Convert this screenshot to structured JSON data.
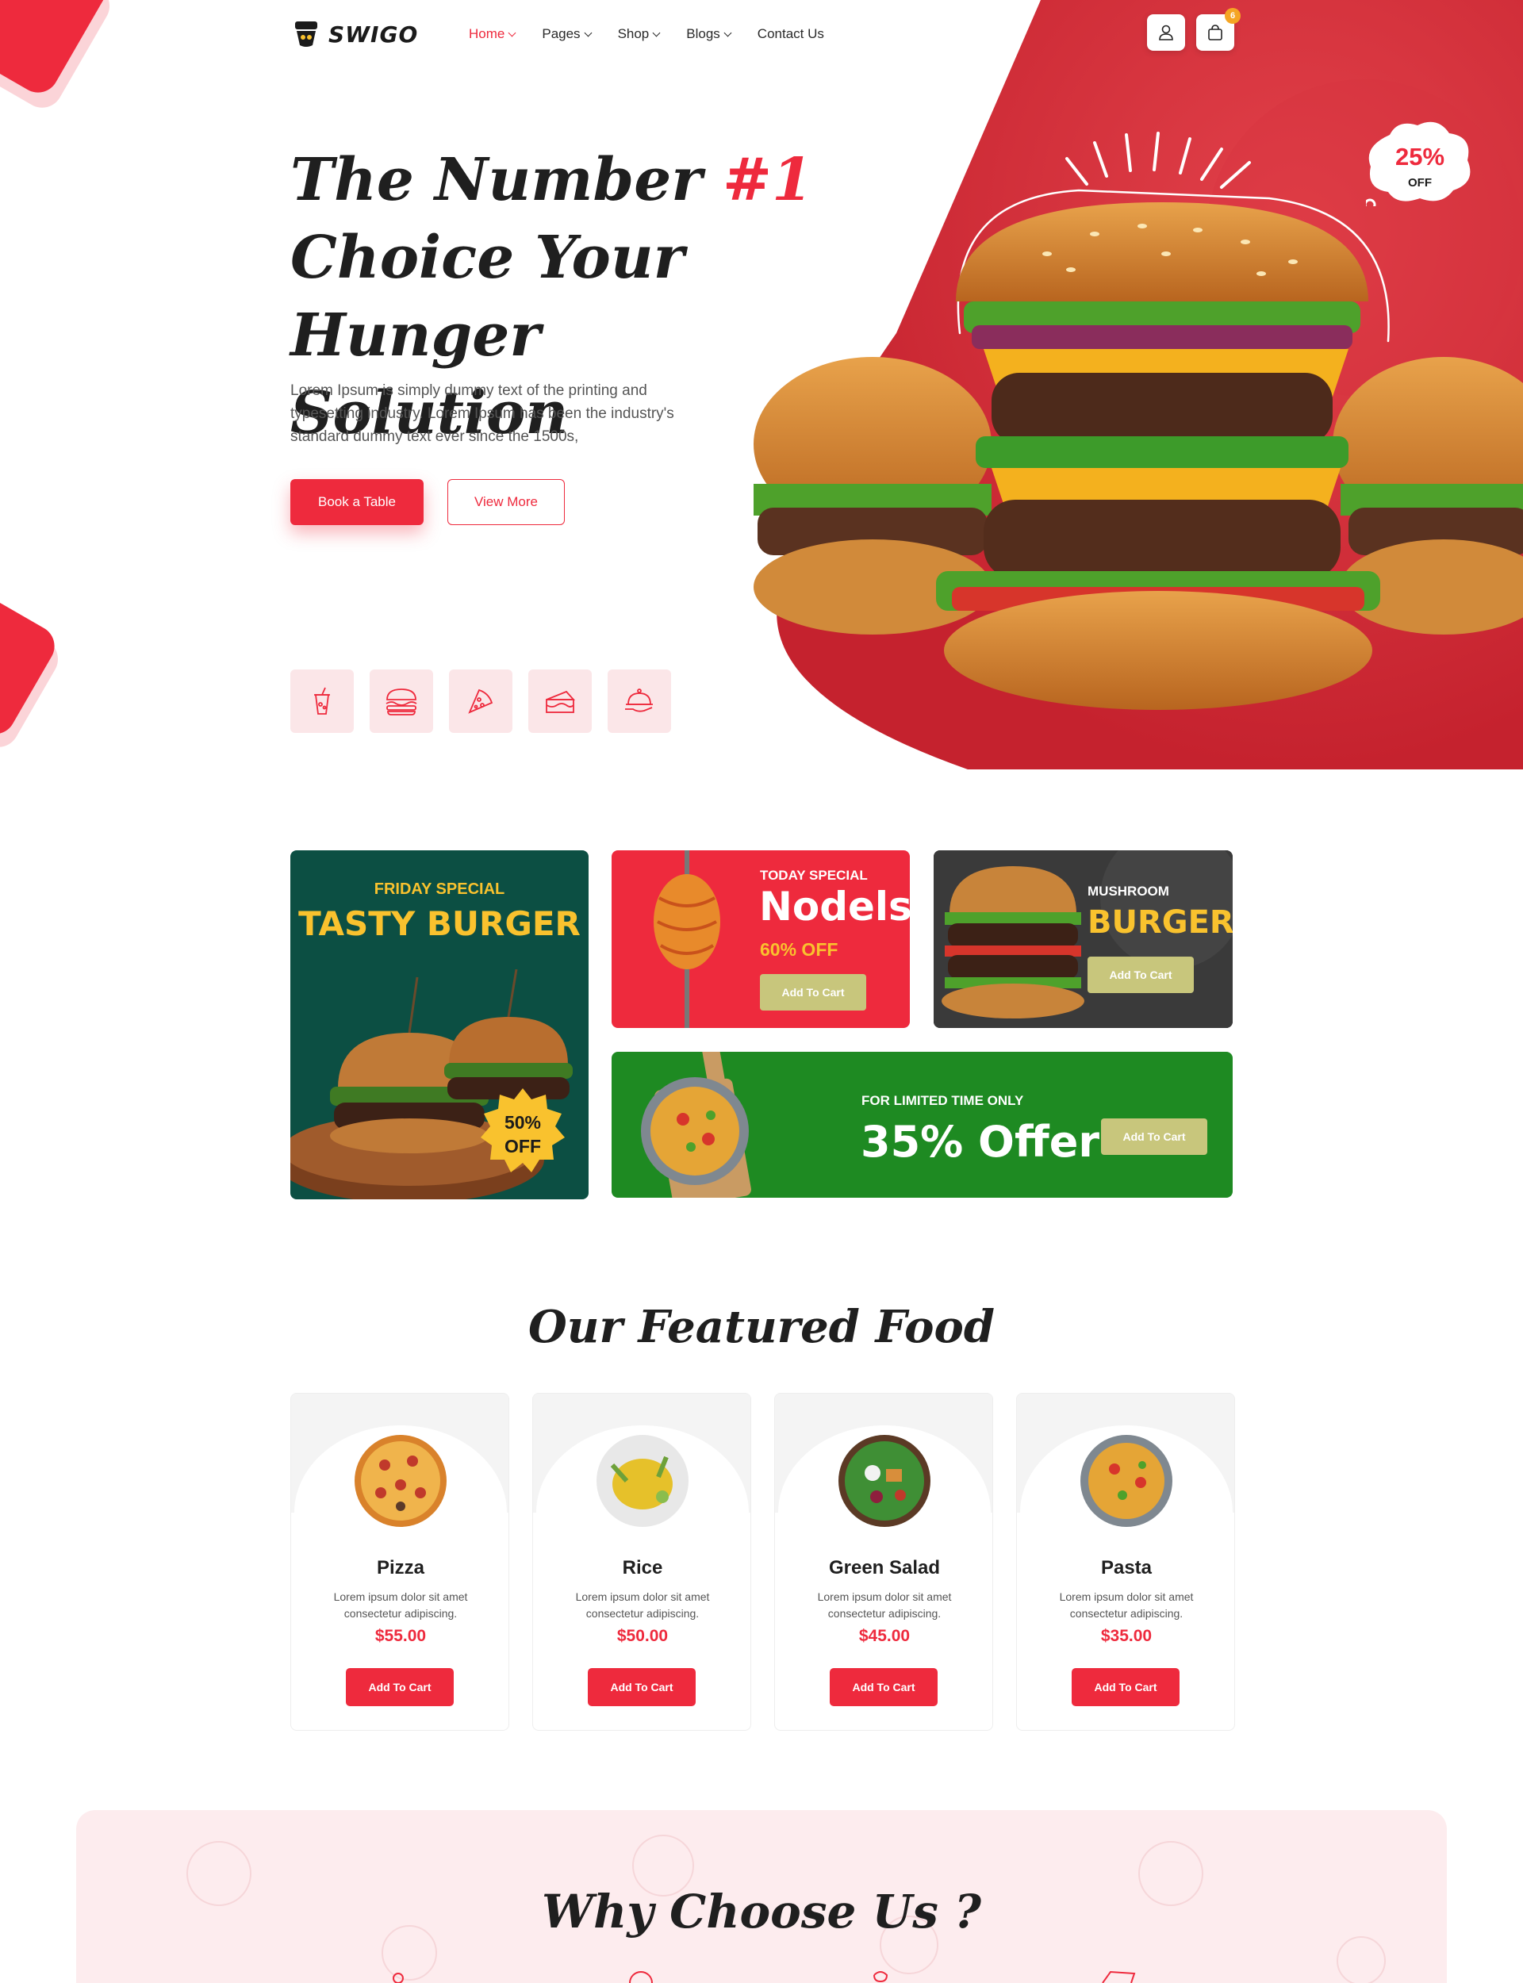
{
  "brand": {
    "name": "SWIGO"
  },
  "nav": {
    "items": [
      {
        "label": "Home",
        "active": true,
        "has_dropdown": true
      },
      {
        "label": "Pages",
        "has_dropdown": true
      },
      {
        "label": "Shop",
        "has_dropdown": true
      },
      {
        "label": "Blogs",
        "has_dropdown": true
      },
      {
        "label": "Contact Us",
        "has_dropdown": false
      }
    ]
  },
  "header_icons": {
    "user": "user-icon",
    "cart": "shopping-bag-icon",
    "cart_count": "6"
  },
  "hero": {
    "title_line1": "The Number ",
    "title_accent": "#1",
    "title_line2": "Choice Your Hunger",
    "title_line3": "Solution",
    "description": "Lorem Ipsum is simply dummy text of the printing and typesetting industry. Lorem Ipsum has been the industry's standard dummy text ever since the 1500s,",
    "primary_button": "Book a Table",
    "secondary_button": "View More",
    "discount_value": "25%",
    "discount_label": "OFF",
    "categories": [
      "drink-icon",
      "burger-icon",
      "pizza-icon",
      "cake-icon",
      "food-serving-icon"
    ]
  },
  "promos": {
    "friday": {
      "kicker": "FRIDAY SPECIAL",
      "title": "TASTY BURGER",
      "badge_value": "50%",
      "badge_label": "OFF"
    },
    "today": {
      "kicker": "TODAY SPECIAL",
      "title": "Nodels",
      "discount": "60% OFF",
      "button": "Add To Cart"
    },
    "mushroom": {
      "kicker": "MUSHROOM",
      "title": "BURGER",
      "button": "Add To Cart"
    },
    "limited": {
      "kicker": "FOR LIMITED TIME ONLY",
      "title": "35% Offer",
      "button": "Add To Cart"
    }
  },
  "featured": {
    "title": "Our Featured Food",
    "items": [
      {
        "name": "Pizza",
        "desc": "Lorem ipsum dolor sit amet consectetur adipiscing.",
        "price": "$55.00",
        "button": "Add To Cart"
      },
      {
        "name": "Rice",
        "desc": "Lorem ipsum dolor sit amet consectetur adipiscing.",
        "price": "$50.00",
        "button": "Add To Cart"
      },
      {
        "name": "Green Salad",
        "desc": "Lorem ipsum dolor sit amet consectetur adipiscing.",
        "price": "$45.00",
        "button": "Add To Cart"
      },
      {
        "name": "Pasta",
        "desc": "Lorem ipsum dolor sit amet consectetur adipiscing.",
        "price": "$35.00",
        "button": "Add To Cart"
      }
    ]
  },
  "why": {
    "title": "Why Choose Us ?"
  },
  "colors": {
    "primary": "#ee2a3d",
    "friday_bg": "#0c4f43",
    "limited_bg": "#1e8a22",
    "promo_button": "#c8c67c",
    "yellow": "#f9c22e"
  }
}
